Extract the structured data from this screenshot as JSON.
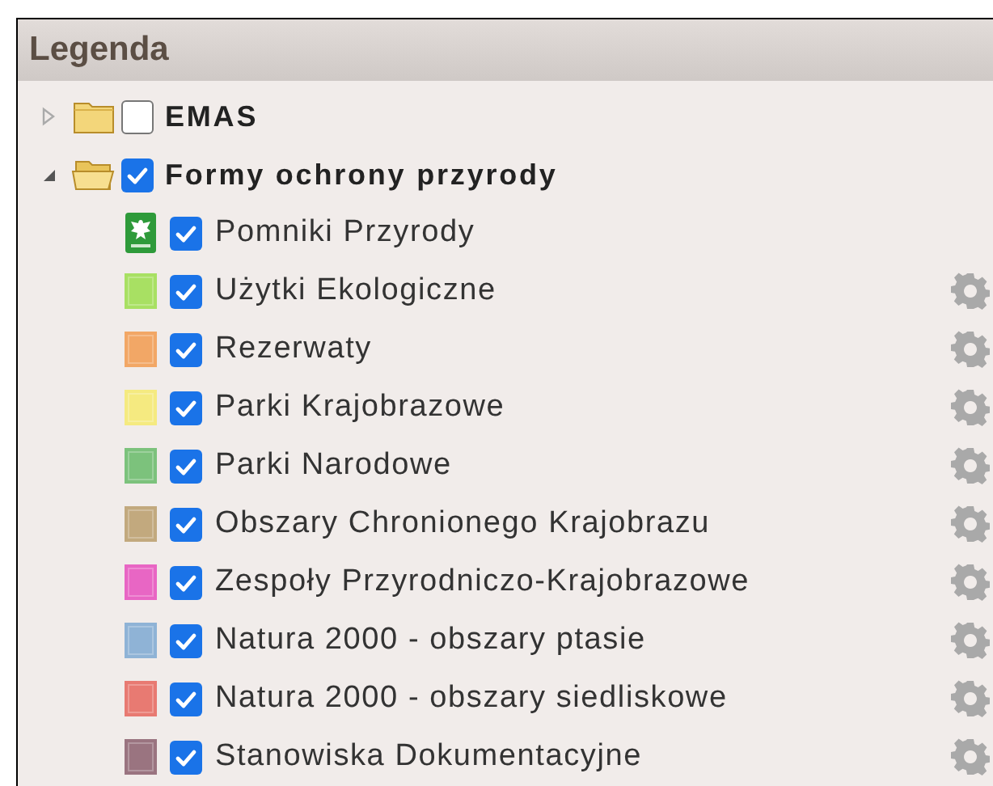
{
  "panel": {
    "title": "Legenda"
  },
  "tree": [
    {
      "label": "EMAS",
      "expanded": false,
      "checked": false
    },
    {
      "label": "Formy ochrony przyrody",
      "expanded": true,
      "checked": true,
      "children": [
        {
          "label": "Pomniki Przyrody",
          "kind": "emblem",
          "checked": true,
          "settings": false
        },
        {
          "label": "Użytki Ekologiczne",
          "kind": "swatch",
          "color": "#a8e063",
          "checked": true,
          "settings": true
        },
        {
          "label": "Rezerwaty",
          "kind": "swatch",
          "color": "#f2a766",
          "checked": true,
          "settings": true
        },
        {
          "label": "Parki Krajobrazowe",
          "kind": "swatch",
          "color": "#f5ea80",
          "checked": true,
          "settings": true
        },
        {
          "label": "Parki Narodowe",
          "kind": "swatch",
          "color": "#7cc27c",
          "checked": true,
          "settings": true
        },
        {
          "label": "Obszary Chronionego Krajobrazu",
          "kind": "swatch",
          "color": "#c2a97e",
          "checked": true,
          "settings": true
        },
        {
          "label": "Zespoły Przyrodniczo-Krajobrazowe",
          "kind": "swatch",
          "color": "#e866c4",
          "checked": true,
          "settings": true
        },
        {
          "label": "Natura 2000 - obszary ptasie",
          "kind": "swatch",
          "color": "#8fb3d6",
          "checked": true,
          "settings": true
        },
        {
          "label": "Natura 2000 - obszary siedliskowe",
          "kind": "swatch",
          "color": "#e87a72",
          "checked": true,
          "settings": true
        },
        {
          "label": "Stanowiska Dokumentacyjne",
          "kind": "swatch",
          "color": "#9a7480",
          "checked": true,
          "settings": true
        }
      ]
    }
  ]
}
